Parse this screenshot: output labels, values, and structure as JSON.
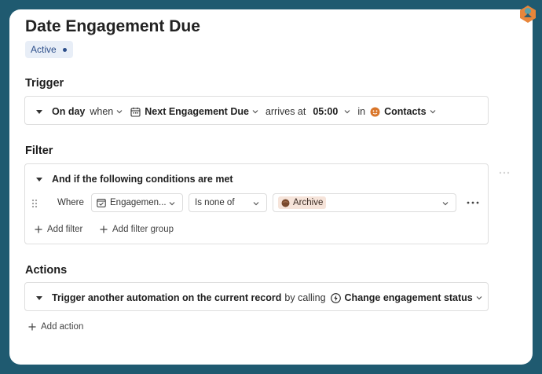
{
  "automation": {
    "title": "Date Engagement Due",
    "status": "Active"
  },
  "trigger": {
    "section_title": "Trigger",
    "when_day": "On day",
    "when_word": "when",
    "field": "Next Engagement Due",
    "arrives_at": "arrives at",
    "time": "05:00",
    "in_word": "in",
    "table": "Contacts"
  },
  "filter": {
    "section_title": "Filter",
    "group_label": "And if the following conditions are met",
    "where_label": "Where",
    "condition_field": "Engagemen...",
    "condition_operator": "Is none of",
    "condition_value": "Archive",
    "add_filter": "Add filter",
    "add_filter_group": "Add filter group"
  },
  "actions": {
    "section_title": "Actions",
    "action_label": "Trigger another automation on the current record",
    "by_calling": "by calling",
    "target": "Change engagement status",
    "add_action": "Add action"
  },
  "colors": {
    "frame_bg": "#1f5a70",
    "status_bg": "#e8eef7",
    "status_text": "#2c4e8a",
    "contacts_icon": "#d9762b",
    "archive_tag_bg": "#f6e4da",
    "archive_icon": "#7a4a2e"
  },
  "icons": {
    "calendar": "calendar-icon",
    "contacts": "face-icon",
    "archive": "archive-dot-icon",
    "calling": "lightning-icon",
    "drag": "drag-handle-icon",
    "more": "more-icon",
    "plus": "plus-icon"
  }
}
